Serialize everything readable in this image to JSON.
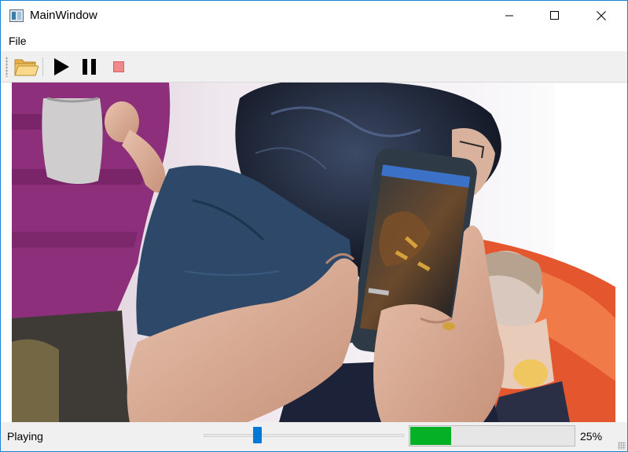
{
  "window": {
    "title": "MainWindow",
    "accent_color": "#1883d7"
  },
  "menu": {
    "items": [
      {
        "label": "File"
      }
    ]
  },
  "toolbar": {
    "buttons": [
      {
        "name": "open",
        "icon": "folder-open-icon"
      },
      {
        "name": "play",
        "icon": "play-icon"
      },
      {
        "name": "pause",
        "icon": "pause-icon"
      },
      {
        "name": "stop",
        "icon": "stop-icon"
      }
    ]
  },
  "video": {
    "content": "video-frame"
  },
  "status": {
    "state_text": "Playing",
    "seek_position": 0.27,
    "progress_value": 25,
    "progress_text": "25%",
    "progress_color": "#06b025"
  }
}
